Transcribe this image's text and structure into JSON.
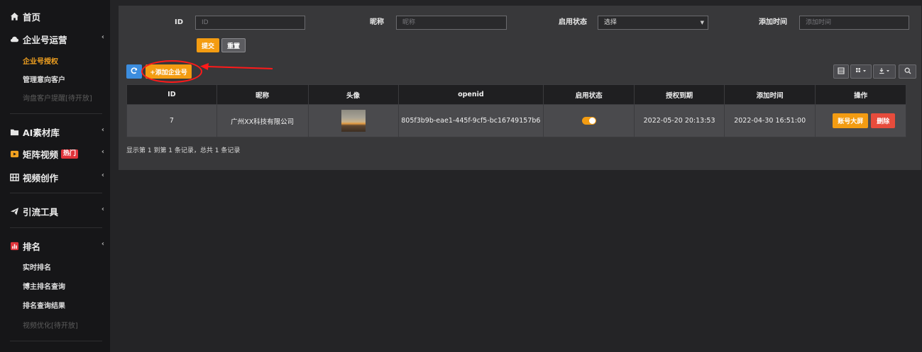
{
  "sidebar": {
    "home": "首页",
    "enterprise": {
      "label": "企业号运营",
      "items": [
        "企业号授权",
        "管理意向客户",
        "询盘客户提醒[待开放]"
      ]
    },
    "ai_material": "AI素材库",
    "matrix_video": {
      "label": "矩阵视频",
      "badge": "热门"
    },
    "video_creation": "视频创作",
    "traffic_tools": "引流工具",
    "ranking": {
      "label": "排名",
      "items": [
        "实时排名",
        "博主排名查询",
        "排名查询结果",
        "视频优化[待开放]"
      ]
    },
    "chevron": "‹"
  },
  "filter": {
    "id_label": "ID",
    "id_placeholder": "ID",
    "nickname_label": "昵称",
    "nickname_placeholder": "昵称",
    "status_label": "启用状态",
    "status_value": "选择",
    "time_label": "添加时间",
    "time_placeholder": "添加时间",
    "submit": "提交",
    "reset": "重置"
  },
  "toolbar": {
    "add_label": "+添加企业号"
  },
  "table": {
    "headers": [
      "ID",
      "昵称",
      "头像",
      "openid",
      "启用状态",
      "授权到期",
      "添加时间",
      "操作"
    ],
    "rows": [
      {
        "id": "7",
        "nickname": "广州XX科技有限公司",
        "openid": "805f3b9b-eae1-445f-9cf5-bc16749157b6",
        "enabled": true,
        "expire": "2022-05-20 20:13:53",
        "added": "2022-04-30 16:51:00",
        "action_screen": "账号大屏",
        "action_delete": "删除"
      }
    ]
  },
  "summary": "显示第 1 到第 1 条记录，总共 1 条记录",
  "colors": {
    "accent": "#f39c12",
    "danger": "#e74c3c",
    "primary": "#3c8dde",
    "annotation": "#ff1a1a"
  }
}
